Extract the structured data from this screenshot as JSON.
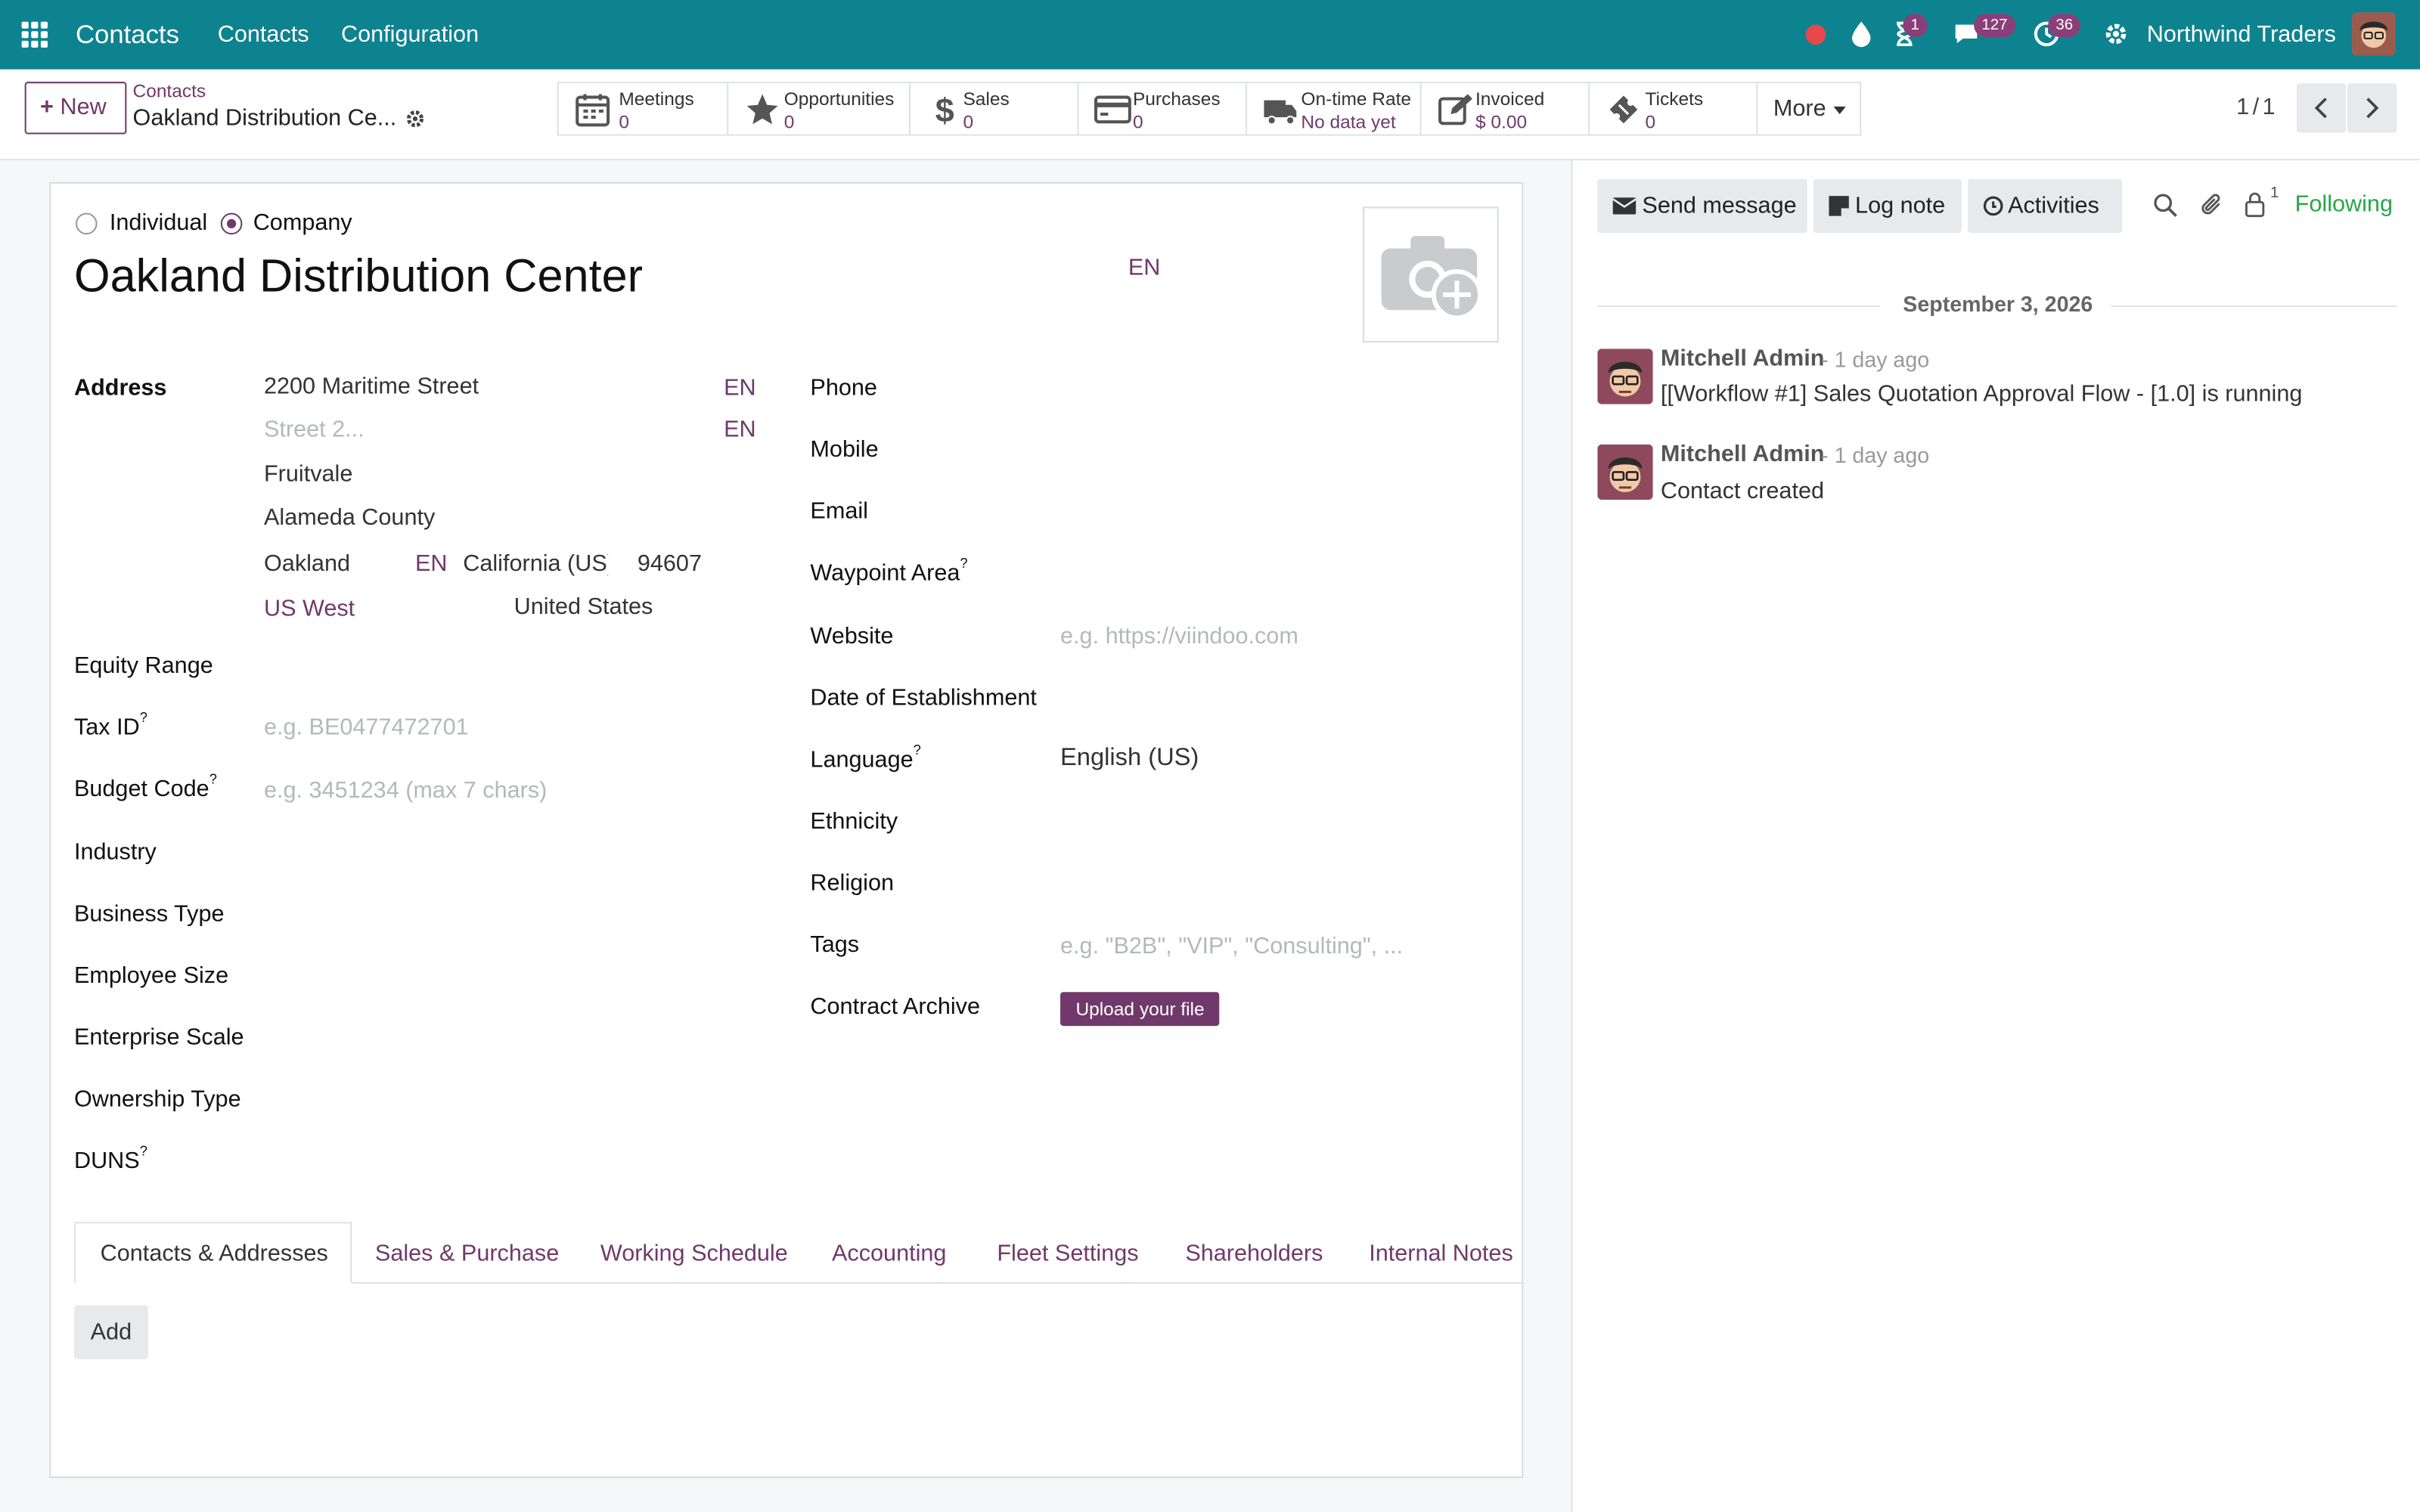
{
  "topbar": {
    "app_name": "Contacts",
    "menu": [
      "Contacts",
      "Configuration"
    ],
    "badges": {
      "activities": "1",
      "messages": "127",
      "clock": "36"
    },
    "company": "Northwind Traders"
  },
  "control_panel": {
    "new_label": "New",
    "breadcrumb_parent": "Contacts",
    "record_title": "Oakland Distribution Ce...",
    "stats": [
      {
        "label": "Meetings",
        "value": "0"
      },
      {
        "label": "Opportunities",
        "value": "0"
      },
      {
        "label": "Sales",
        "value": "0"
      },
      {
        "label": "Purchases",
        "value": "0"
      },
      {
        "label": "On-time Rate",
        "value": "No data yet"
      },
      {
        "label": "Invoiced",
        "value": "$ 0.00"
      },
      {
        "label": "Tickets",
        "value": "0"
      }
    ],
    "more_label": "More",
    "pager": "1 / 1"
  },
  "form": {
    "type_options": [
      "Individual",
      "Company"
    ],
    "selected_type": "Company",
    "name": "Oakland Distribution Center",
    "lang_badge": "EN",
    "address": {
      "label": "Address",
      "street": "2200 Maritime Street",
      "street2_placeholder": "Street 2...",
      "district": "Fruitvale",
      "county": "Alameda County",
      "city": "Oakland",
      "state": "California (US)",
      "zip": "94607",
      "region": "US West",
      "country": "United States"
    },
    "left_fields": [
      {
        "label": "Equity Range",
        "value": ""
      },
      {
        "label": "Tax ID",
        "help": "?",
        "placeholder": "e.g. BE0477472701"
      },
      {
        "label": "Budget Code",
        "help": "?",
        "placeholder": "e.g. 3451234 (max 7 chars)"
      },
      {
        "label": "Industry",
        "value": ""
      },
      {
        "label": "Business Type",
        "value": ""
      },
      {
        "label": "Employee Size",
        "value": ""
      },
      {
        "label": "Enterprise Scale",
        "value": ""
      },
      {
        "label": "Ownership Type",
        "value": ""
      },
      {
        "label": "DUNS",
        "help": "?",
        "value": ""
      }
    ],
    "right_fields": [
      {
        "label": "Phone",
        "value": ""
      },
      {
        "label": "Mobile",
        "value": ""
      },
      {
        "label": "Email",
        "value": ""
      },
      {
        "label": "Waypoint Area",
        "help": "?",
        "value": ""
      },
      {
        "label": "Website",
        "placeholder": "e.g. https://viindoo.com"
      },
      {
        "label": "Date of Establishment",
        "value": ""
      },
      {
        "label": "Language",
        "help": "?",
        "value": "English (US)"
      },
      {
        "label": "Ethnicity",
        "value": ""
      },
      {
        "label": "Religion",
        "value": ""
      },
      {
        "label": "Tags",
        "placeholder": "e.g. \"B2B\", \"VIP\", \"Consulting\", ..."
      },
      {
        "label": "Contract Archive",
        "button": "Upload your file"
      }
    ],
    "tabs": [
      "Contacts & Addresses",
      "Sales & Purchase",
      "Working Schedule",
      "Accounting",
      "Fleet Settings",
      "Shareholders",
      "Internal Notes"
    ],
    "active_tab": "Contacts & Addresses",
    "add_label": "Add"
  },
  "chatter": {
    "send_message": "Send message",
    "log_note": "Log note",
    "activities": "Activities",
    "followers_count": "1",
    "following": "Following",
    "date": "September 3, 2026",
    "messages": [
      {
        "author": "Mitchell Admin",
        "time": "- 1 day ago",
        "body": "[[Workflow #1] Sales Quotation Approval Flow - [1.0] is running"
      },
      {
        "author": "Mitchell Admin",
        "time": "- 1 day ago",
        "body": "Contact created"
      }
    ]
  },
  "colors": {
    "topbar": "#0e8390",
    "accent": "#71396b",
    "following": "#28a745",
    "badge": "#8a3f78"
  }
}
